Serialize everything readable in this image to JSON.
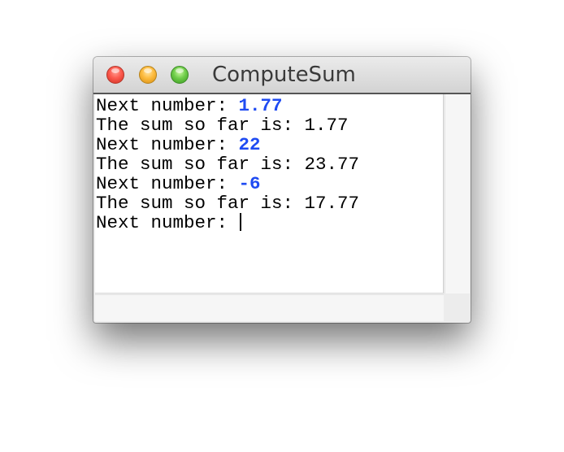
{
  "window": {
    "title": "ComputeSum"
  },
  "colors": {
    "input_text": "#1f4bf2",
    "output_text": "#000000"
  },
  "console": {
    "lines": [
      {
        "prompt": "Next number: ",
        "input": "1.77"
      },
      {
        "output": "The sum so far is: 1.77"
      },
      {
        "prompt": "Next number: ",
        "input": "22"
      },
      {
        "output": "The sum so far is: 23.77"
      },
      {
        "prompt": "Next number: ",
        "input": "-6"
      },
      {
        "output": "The sum so far is: 17.77"
      },
      {
        "prompt": "Next number: ",
        "input": ""
      }
    ]
  }
}
